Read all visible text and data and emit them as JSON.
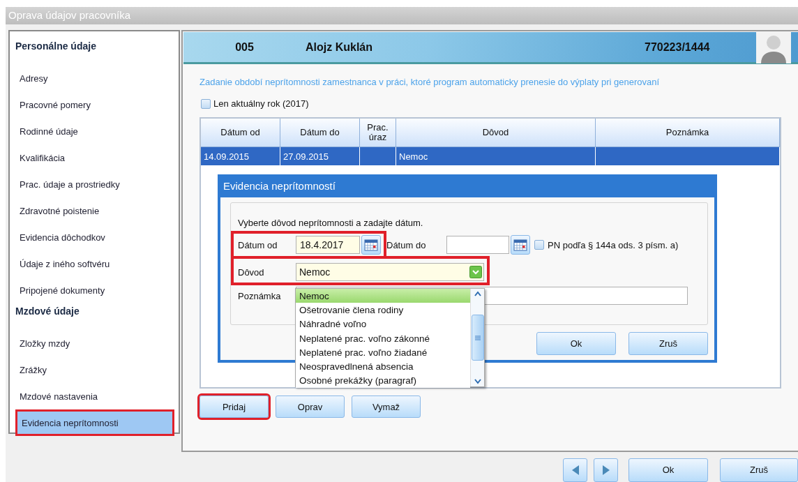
{
  "window": {
    "title": "Oprava údajov pracovníka"
  },
  "sidebar": {
    "sections": [
      {
        "heading": "Personálne údaje",
        "items": [
          {
            "label": "Adresy",
            "selected": false,
            "highlighted": false
          },
          {
            "label": "Pracovné pomery",
            "selected": false,
            "highlighted": false
          },
          {
            "label": "Rodinné údaje",
            "selected": false,
            "highlighted": false
          },
          {
            "label": "Kvalifikácia",
            "selected": false,
            "highlighted": false
          },
          {
            "label": "Prac. údaje a prostriedky",
            "selected": false,
            "highlighted": false
          },
          {
            "label": "Zdravotné poistenie",
            "selected": false,
            "highlighted": false
          },
          {
            "label": "Evidencia dôchodkov",
            "selected": false,
            "highlighted": false
          },
          {
            "label": "Údaje z iného softvéru",
            "selected": false,
            "highlighted": false
          },
          {
            "label": "Pripojené dokumenty",
            "selected": false,
            "highlighted": false
          }
        ]
      },
      {
        "heading": "Mzdové údaje",
        "items": [
          {
            "label": "Zložky mzdy",
            "selected": false,
            "highlighted": false
          },
          {
            "label": "Zrážky",
            "selected": false,
            "highlighted": false
          },
          {
            "label": "Mzdové nastavenia",
            "selected": false,
            "highlighted": false
          },
          {
            "label": "Evidencia neprítomnosti",
            "selected": true,
            "highlighted": true
          }
        ]
      }
    ]
  },
  "header": {
    "number": "005",
    "name": "Alojz Kuklán",
    "id": "770223/1444"
  },
  "description": "Zadanie období neprítomnosti zamestnanca v práci, ktoré program automaticky prenesie do výplaty pri generovaní",
  "filter": {
    "label": "Len aktuálny rok (2017)",
    "checked": false
  },
  "table": {
    "columns": [
      "Dátum od",
      "Dátum do",
      "Prac. úraz",
      "Dôvod",
      "Poznámka"
    ],
    "rows": [
      {
        "cells": [
          "14.09.2015",
          "27.09.2015",
          "",
          "Nemoc",
          ""
        ],
        "selected": true
      }
    ]
  },
  "actions": [
    {
      "label": "Pridaj",
      "highlighted": true
    },
    {
      "label": "Oprav",
      "highlighted": false
    },
    {
      "label": "Vymaž",
      "highlighted": false
    }
  ],
  "dialog": {
    "title": "Evidencia neprítomností",
    "instruction": "Vyberte dôvod neprítomnosti a zadajte dátum.",
    "date_from": {
      "label": "Dátum od",
      "value": "18.4.2017",
      "highlighted": true
    },
    "date_to": {
      "label": "Dátum do"
    },
    "pn": {
      "label": "PN podľa § 144a ods. 3 písm. a)",
      "checked": false
    },
    "reason": {
      "label": "Dôvod",
      "value": "Nemoc",
      "highlighted": true,
      "options": [
        {
          "label": "Nemoc",
          "selected": true
        },
        {
          "label": "Ošetrovanie člena rodiny",
          "selected": false
        },
        {
          "label": "Náhradné voľno",
          "selected": false
        },
        {
          "label": "Neplatené prac. voľno zákonné",
          "selected": false
        },
        {
          "label": "Neplatené prac. voľno žiadané",
          "selected": false
        },
        {
          "label": "Neospravedlnená absencia",
          "selected": false
        },
        {
          "label": "Osobné prekážky (paragraf)",
          "selected": false
        }
      ]
    },
    "note": {
      "label": "Poznámka"
    },
    "buttons": [
      "Ok",
      "Zruš"
    ]
  },
  "footer": {
    "buttons": [
      "Ok",
      "Zruš"
    ]
  }
}
